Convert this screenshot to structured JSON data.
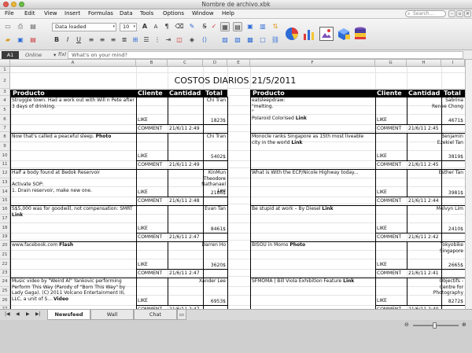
{
  "window": {
    "title": "Nombre de archivo.xbk",
    "search_placeholder": "Search..."
  },
  "menu": [
    "File",
    "Edit",
    "View",
    "Insert",
    "Formulas",
    "Data",
    "Tools",
    "Options",
    "Window",
    "Help"
  ],
  "toolbar": {
    "style_value": "Data loaded",
    "size_value": "10"
  },
  "formula_bar": {
    "cell_ref": "A1",
    "status": "Online",
    "fx": "f(x)",
    "input_placeholder": "What's on your mind?"
  },
  "columns": [
    "A",
    "B",
    "C",
    "D",
    "E",
    "F",
    "G",
    "H",
    "I"
  ],
  "rows": [
    "1",
    "2",
    "3",
    "4",
    "5",
    "6",
    "7",
    "8",
    "9",
    "10",
    "11",
    "12",
    "13",
    "14",
    "15",
    "16",
    "17",
    "18",
    "19",
    "20",
    "21",
    "22",
    "23",
    "24",
    "25",
    "26",
    "27"
  ],
  "sheet": {
    "title": "COSTOS DIARIOS 21/5/2011",
    "headers": {
      "producto": "Producto",
      "cliente": "Cliente",
      "cantidad": "Cantidad",
      "total": "Total"
    },
    "like_label": "LIKE",
    "comment_label": "COMMENT",
    "left": [
      {
        "text": "Struggle town. Had a work out with Will n Pete after 3 days of drinking.",
        "link": "",
        "name": "Chi Tran",
        "total": "1823$",
        "date": "21/6/11 2:49"
      },
      {
        "text": "Now that's called a peaceful sleep.",
        "link": "Photo",
        "name": "Chi Tran",
        "total": "5402$",
        "date": "21/6/11 2:49"
      },
      {
        "text": "Half a body found at Bedok Reservoir\n\nActivate SOP:\n1. Drain reservoir, make new one.",
        "link": "",
        "name": "KinMun Theodore Nathanael Lee",
        "total": "2186$",
        "date": "21/6/11 2:48"
      },
      {
        "text": "S$5,000 was for goodwill, not compensation: SMRT",
        "link": "Link",
        "name": "Evan Tan",
        "total": "8461$",
        "date": "21/6/11 2:47"
      },
      {
        "text": "www.facebook.com",
        "link": "Flash",
        "name": "Darren Ho",
        "total": "3620$",
        "date": "21/6/11 2:47"
      },
      {
        "text": "Music video by \"Weird Al\" Yankovic performing Perform This Way (Parody of \"Born This Way\" by Lady Gaga). (C) 2011 Volcano Entertainment III, LLC, a unit of S...",
        "link": "Video",
        "name": "Xander Lee",
        "total": "6953$",
        "date": "21/6/11 2:47"
      }
    ],
    "right": [
      {
        "text": "eatsleepdraw:\n\"melting.\n\"\nPolaroid Colorised",
        "link": "Link",
        "name": "Sabrina Renee Chong",
        "total": "4671$",
        "date": "21/6/11 2:45"
      },
      {
        "text": "Monocle ranks Singapore as 15th most liveable city in the world",
        "link": "Link",
        "name": "Benjamin Ezekiel Tan",
        "total": "3819$",
        "date": "21/6/11 2:45"
      },
      {
        "text": "What is With the ECP/Nicole Highway today...",
        "link": "",
        "name": "Esther Tan",
        "total": "3981$",
        "date": "21/6/11 2:44"
      },
      {
        "text": "Be stupid at work – By Diesel",
        "link": "Link",
        "name": "Melvyn Lim",
        "total": "2410$",
        "date": "21/6/11 2:42"
      },
      {
        "text": "BISOU in Momo",
        "link": "Photo",
        "name": "Tokyobike Singapore",
        "total": "2665$",
        "date": "21/6/11 2:41"
      },
      {
        "text": "SFMOMA | Bill Viola Exhibition Feature",
        "link": "Link",
        "name": "Objectifs - Centre for Photography",
        "total": "8272$",
        "date": "21/6/11 2:40"
      }
    ]
  },
  "tabs": [
    "Newsfeed",
    "Wall",
    "Chat"
  ],
  "colors": {
    "header_band": "#000000",
    "grid_line": "#e4e4e4",
    "accent_blue": "#2d6bd6"
  }
}
